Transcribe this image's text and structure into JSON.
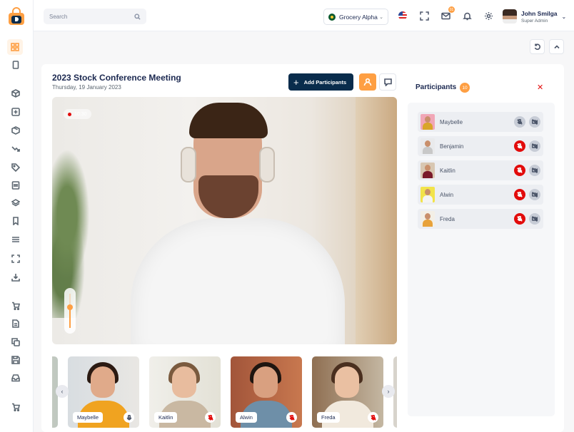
{
  "topbar": {
    "search_placeholder": "Search",
    "store_name": "Grocery Alpha",
    "mail_badge": "01",
    "user_name": "John Smilga",
    "user_role": "Super Admin"
  },
  "meeting": {
    "title": "2023 Stock Conference Meeting",
    "date": "Thursday, 19 January 2023",
    "add_participants_label": "Add Participants",
    "recording_time": "10:30",
    "volume_level": 0.6,
    "volume_value": "63"
  },
  "thumbnails": [
    {
      "name": "Maybelle",
      "muted": false
    },
    {
      "name": "Kaitlin",
      "muted": true
    },
    {
      "name": "Alwin",
      "muted": true
    },
    {
      "name": "Freda",
      "muted": true
    }
  ],
  "participants_panel": {
    "title": "Participants",
    "count": "10",
    "list": [
      {
        "name": "Maybelle",
        "mic_muted_red": false
      },
      {
        "name": "Benjamin",
        "mic_muted_red": true
      },
      {
        "name": "Kaitlin",
        "mic_muted_red": true
      },
      {
        "name": "Alwin",
        "mic_muted_red": true
      },
      {
        "name": "Freda",
        "mic_muted_red": true
      }
    ]
  },
  "colors": {
    "accent": "#fe9f43",
    "primary_dark": "#092c4c",
    "danger": "#e20b0b"
  }
}
